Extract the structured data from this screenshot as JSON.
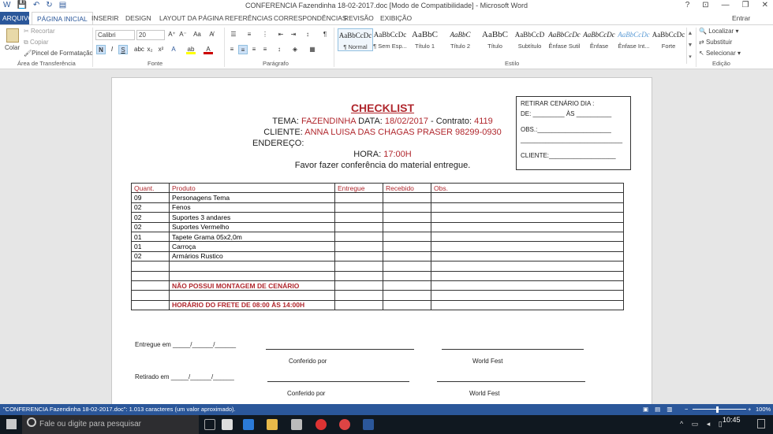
{
  "window": {
    "title": "CONFERENCIA Fazendinha 18-02-2017.doc [Modo de Compatibilidade] - Microsoft Word",
    "help": "?",
    "minimize": "—",
    "restore": "❐",
    "close": "✕"
  },
  "tabs": {
    "file": "ARQUIVO",
    "home": "PÁGINA INICIAL",
    "insert": "INSERIR",
    "design": "DESIGN",
    "layout": "LAYOUT DA PÁGINA",
    "references": "REFERÊNCIAS",
    "mailings": "CORRESPONDÊNCIAS",
    "review": "REVISÃO",
    "view": "EXIBIÇÃO",
    "signin": "Entrar"
  },
  "clipboard": {
    "paste": "Colar",
    "cut": "Recortar",
    "copy": "Copiar",
    "format_painter": "Pincel de Formatação",
    "label": "Área de Transferência"
  },
  "font": {
    "name": "Calibri",
    "size": "20",
    "label": "Fonte"
  },
  "paragraph": {
    "label": "Parágrafo"
  },
  "styles": {
    "label": "Estilo",
    "items": [
      {
        "sample": "AaBbCcDc",
        "name": "¶ Normal"
      },
      {
        "sample": "AaBbCcDc",
        "name": "¶ Sem Esp..."
      },
      {
        "sample": "AaBbC",
        "name": "Título 1"
      },
      {
        "sample": "AaBbC",
        "name": "Título 2"
      },
      {
        "sample": "AaBbC",
        "name": "Título"
      },
      {
        "sample": "AaBbCcD",
        "name": "Subtítulo"
      },
      {
        "sample": "AaBbCcDc",
        "name": "Ênfase Sutil"
      },
      {
        "sample": "AaBbCcDc",
        "name": "Ênfase"
      },
      {
        "sample": "AaBbCcDc",
        "name": "Ênfase Int..."
      },
      {
        "sample": "AaBbCcDc",
        "name": "Forte"
      }
    ]
  },
  "editing": {
    "find": "Localizar",
    "replace": "Substituir",
    "select": "Selecionar",
    "label": "Edição"
  },
  "doc": {
    "title": "CHECKLIST",
    "tema_label": "TEMA:",
    "tema_value": "FAZENDINHA",
    "data_label": "DATA:",
    "data_value": "18/02/2017",
    "contrato_label": "- Contrato:",
    "contrato_value": "4119",
    "cliente_label": "CLIENTE:",
    "cliente_value": "ANNA LUISA DAS CHAGAS PRASER 98299-0930",
    "endereco_label": "ENDEREÇO:",
    "hora_label": "HORA:",
    "hora_value": "17:00H",
    "instruction": "Favor fazer conferência do material entregue.",
    "box": {
      "line1": "RETIRAR CENÁRIO DIA :",
      "line2": "DE: _________ ÀS __________",
      "line3": "OBS.:_____________________",
      "line4": "_____________________________",
      "line5": "CLIENTE:___________________"
    },
    "table": {
      "headers": [
        "Quant.",
        "Produto",
        "Entregue",
        "Recebido",
        "Obs."
      ],
      "rows": [
        [
          "09",
          "Personagens Tema"
        ],
        [
          "02",
          "Fenos"
        ],
        [
          "02",
          "Suportes 3 andares"
        ],
        [
          "02",
          "Suportes Vermelho"
        ],
        [
          "01",
          "Tapete Grama 05x2,0m"
        ],
        [
          "01",
          "Carroça"
        ],
        [
          "02",
          "Armários Rustico"
        ],
        [
          "",
          ""
        ],
        [
          "",
          ""
        ],
        [
          "",
          "NÃO POSSUI MONTAGEM DE CENÁRIO"
        ],
        [
          "",
          ""
        ],
        [
          "",
          "HORÁRIO DO FRETE DE 08:00 ÀS 14:00H"
        ]
      ]
    },
    "entregue": "Entregue em _____/______/______",
    "retirado": "Retirado em _____/______/______",
    "conferido": "Conferido por",
    "worldfest": "World Fest"
  },
  "status": {
    "text": "\"CONFERENCIA Fazendinha 18-02-2017.doc\": 1.013 caracteres (um valor aproximado).",
    "zoom": "100%"
  },
  "taskbar": {
    "search_placeholder": "Fale ou digite para pesquisar",
    "time": "10:45"
  }
}
